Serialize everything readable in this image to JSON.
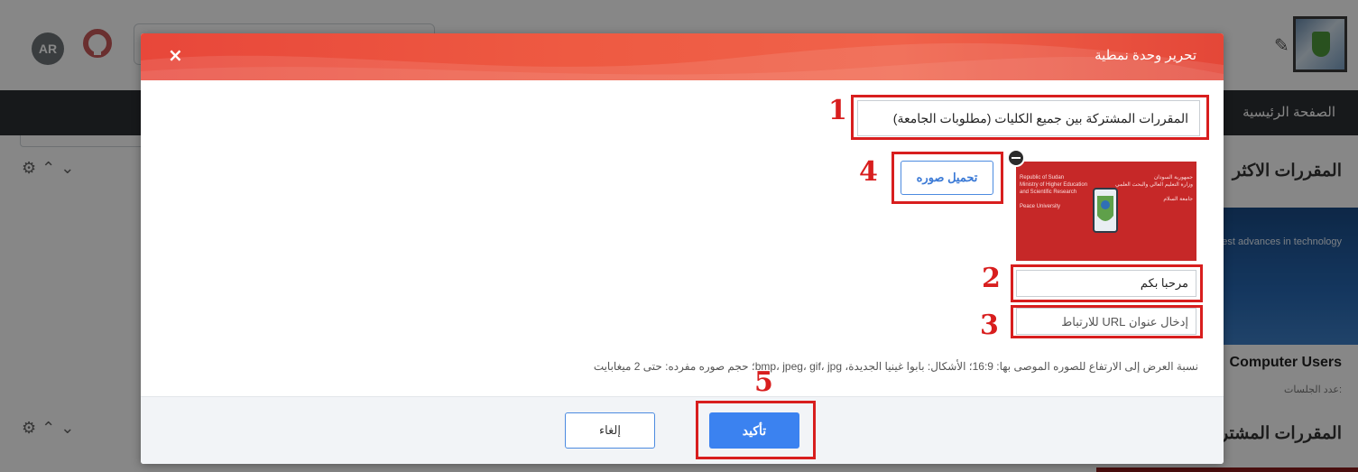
{
  "header": {
    "lang_badge": "AR",
    "nav_home": "الصفحة الرئيسية"
  },
  "background": {
    "section1_title": "المقررات الاكثر",
    "section2_title": "المقررات المشتر",
    "card_banner_text": "est advances in technology",
    "card_title": "Computer Users",
    "card_sub": "عدد الجلسات:"
  },
  "modal": {
    "title": "تحرير وحدة نمطية",
    "close_label": "×",
    "title_input_value": "المقررات المشتركة بين جميع الكليات (مطلوبات الجامعة)",
    "upload_label": "تحميل صوره",
    "caption_value": "مرحبا بكم",
    "url_placeholder": "إدخال عنوان URL للارتباط",
    "hint": "نسبة العرض إلى الارتفاع للصوره الموصى بها: 16:9؛ الأشكال: بابوا غينيا الجديدة، bmp، jpeg، gif، jpg؛ حجم صوره مفرده: حتى 2 ميغابايت",
    "confirm_label": "تأكيد",
    "cancel_label": "إلغاء",
    "preview": {
      "left_lines": [
        "Republic of Sudan",
        "Ministry of Higher Education",
        "and Scientific Research",
        "",
        "Peace University"
      ],
      "right_lines": [
        "جمهورية السودان",
        "وزارة التعليم العالي والبحث العلمي",
        "",
        "جامعة السلام"
      ]
    }
  },
  "annotations": [
    "1",
    "2",
    "3",
    "4",
    "5"
  ],
  "colors": {
    "header_red": "#e8473a",
    "annotation_red": "#d81e1e",
    "primary_blue": "#3b82f0",
    "nav_dark": "#2d3033"
  }
}
